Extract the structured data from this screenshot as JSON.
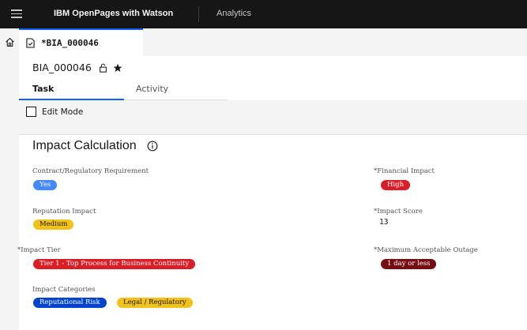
{
  "app": {
    "brand_bold": "IBM ",
    "brand_name": "OpenPages with Watson",
    "nav_analytics": "Analytics"
  },
  "tabs": {
    "document_tab": "*BIA_000046"
  },
  "record": {
    "title": "BIA_000046",
    "tabs": [
      "Task",
      "Activity"
    ],
    "edit_mode_label": "Edit Mode"
  },
  "section": {
    "title": "Impact Calculation"
  },
  "fields": {
    "contract_label": "Contract/Regulatory Requirement",
    "contract_value": "Yes",
    "financial_label": "*Financial Impact",
    "financial_value": "High",
    "reputation_label": "Reputation Impact",
    "reputation_value": "Medium",
    "score_label": "*Impact Score",
    "score_value": "13",
    "tier_label": "*Impact Tier",
    "tier_value": "Tier 1 - Top Process for Business Continuity",
    "outage_label": "*Maximum Acceptable Outage",
    "outage_value": "1 day or less",
    "categories_label": "Impact Categories",
    "categories": [
      "Reputational Risk",
      "Legal / Regulatory"
    ]
  },
  "colors": {
    "accent": "#0f62fe",
    "tag_blue": "#4589ff",
    "tag_darkblue": "#0043ce",
    "tag_red": "#da1e28",
    "tag_darkred": "#750e13",
    "tag_yellow": "#f1c21b"
  },
  "icons": [
    "hamburger-icon",
    "home-icon",
    "document-icon",
    "unlock-icon",
    "star-icon",
    "info-icon",
    "checkbox"
  ]
}
